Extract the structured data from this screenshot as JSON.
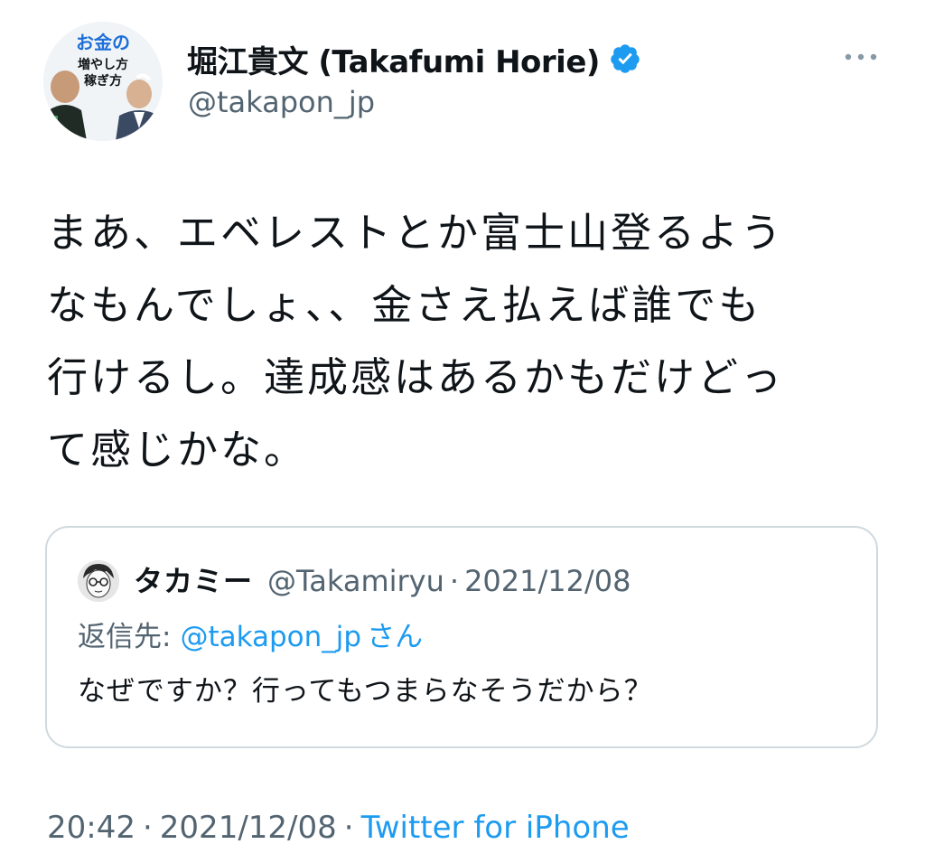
{
  "author": {
    "display_name": "堀江貴文 (Takafumi Horie)",
    "handle": "@takapon_jp",
    "verified": true,
    "avatar_icon": "avatar-book-cover-icon",
    "avatar_text": [
      "お金の",
      "増やし方",
      "稼ぎ方"
    ]
  },
  "tweet": {
    "lines": [
      "まあ、エベレストとか富士山登るよう",
      "なもんでしょ、、金さえ払えば誰でも",
      "行けるし。達成感はあるかもだけどっ",
      "て感じかな。"
    ]
  },
  "quoted": {
    "display_name": "タカミー",
    "handle": "@Takamiryu",
    "separator": "·",
    "date": "2021/12/08",
    "reply_label": "返信先:",
    "reply_user": "@takapon_jp",
    "reply_suffix": "さん",
    "text": "なぜですか？行ってもつまらなそうだから？"
  },
  "meta": {
    "time": "20:42",
    "separator": "·",
    "date": "2021/12/08",
    "source": "Twitter for iPhone"
  },
  "colors": {
    "text": "#0f1419",
    "secondary": "#536471",
    "link": "#1d9bf0",
    "border": "#cfd9de",
    "verified": "#1d9bf0"
  }
}
